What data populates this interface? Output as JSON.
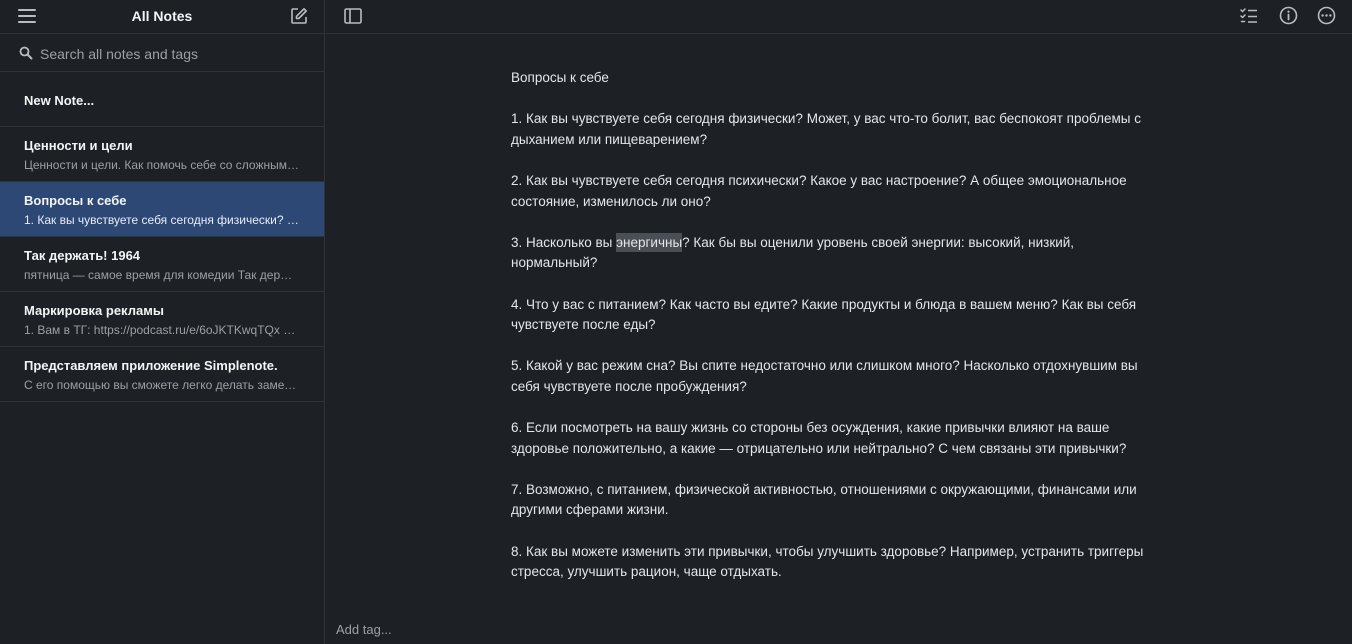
{
  "sidebar": {
    "title": "All Notes",
    "search": {
      "placeholder": "Search all notes and tags",
      "value": ""
    },
    "new_note_label": "New Note...",
    "notes": [
      {
        "title": "Ценности и цели",
        "preview": "Ценности и цели. Как помочь себе со сложным вы..."
      },
      {
        "title": "Вопросы к себе",
        "preview": "1. Как вы чувствуете себя сегодня физически? Мож...",
        "selected": true
      },
      {
        "title": "Так держать! 1964",
        "preview": "пятница — самое время для комедии Так держать! ..."
      },
      {
        "title": "Маркировка рекламы",
        "preview": "1. Вам в ТГ: https://podcast.ru/e/6oJKTKwqTQx 2. ВЦ: ..."
      },
      {
        "title": "Представляем приложение Simplenote.",
        "preview": "С его помощью вы сможете легко делать заметки, с..."
      }
    ]
  },
  "editor": {
    "title_line": "Вопросы к себе",
    "p1": "1. Как вы чувствуете себя сегодня физически? Может, у вас что-то болит, вас беспокоят проблемы с дыханием или пищеварением?",
    "p2": "2. Как вы чувствуете себя сегодня психически? Какое у вас настроение? А общее эмоциональное состояние, изменилось ли оно?",
    "p3_before": "3. Насколько вы ",
    "p3_highlight": "энергичны",
    "p3_after": "? Как бы вы оценили уровень своей энергии: высокий, низкий, нормальный?",
    "p4": "4. Что у вас с питанием? Как часто вы едите? Какие продукты и блюда в вашем меню? Как вы себя чувствуете после еды?",
    "p5": "5. Какой у вас режим сна? Вы спите недостаточно или слишком много? Насколько отдохнувшим вы себя чувствуете после пробуждения?",
    "p6": "6. Если посмотреть на вашу жизнь со стороны без осуждения, какие привычки влияют на ваше здоровье положительно, а какие — отрицательно или нейтрально? С чем связаны эти привычки?",
    "p7": "7. Возможно, с питанием, физической активностью, отношениями с окружающими, финансами или другими сферами жизни.",
    "p8": "8. Как вы можете изменить эти привычки, чтобы улучшить здоровье? Например, устранить триггеры стресса, улучшить рацион, чаще отдыхать."
  },
  "tags": {
    "placeholder": "Add tag..."
  },
  "colors": {
    "background": "#1d2125",
    "selected": "#2d4875",
    "highlight": "#4a4f55",
    "divider": "#2e3338"
  }
}
